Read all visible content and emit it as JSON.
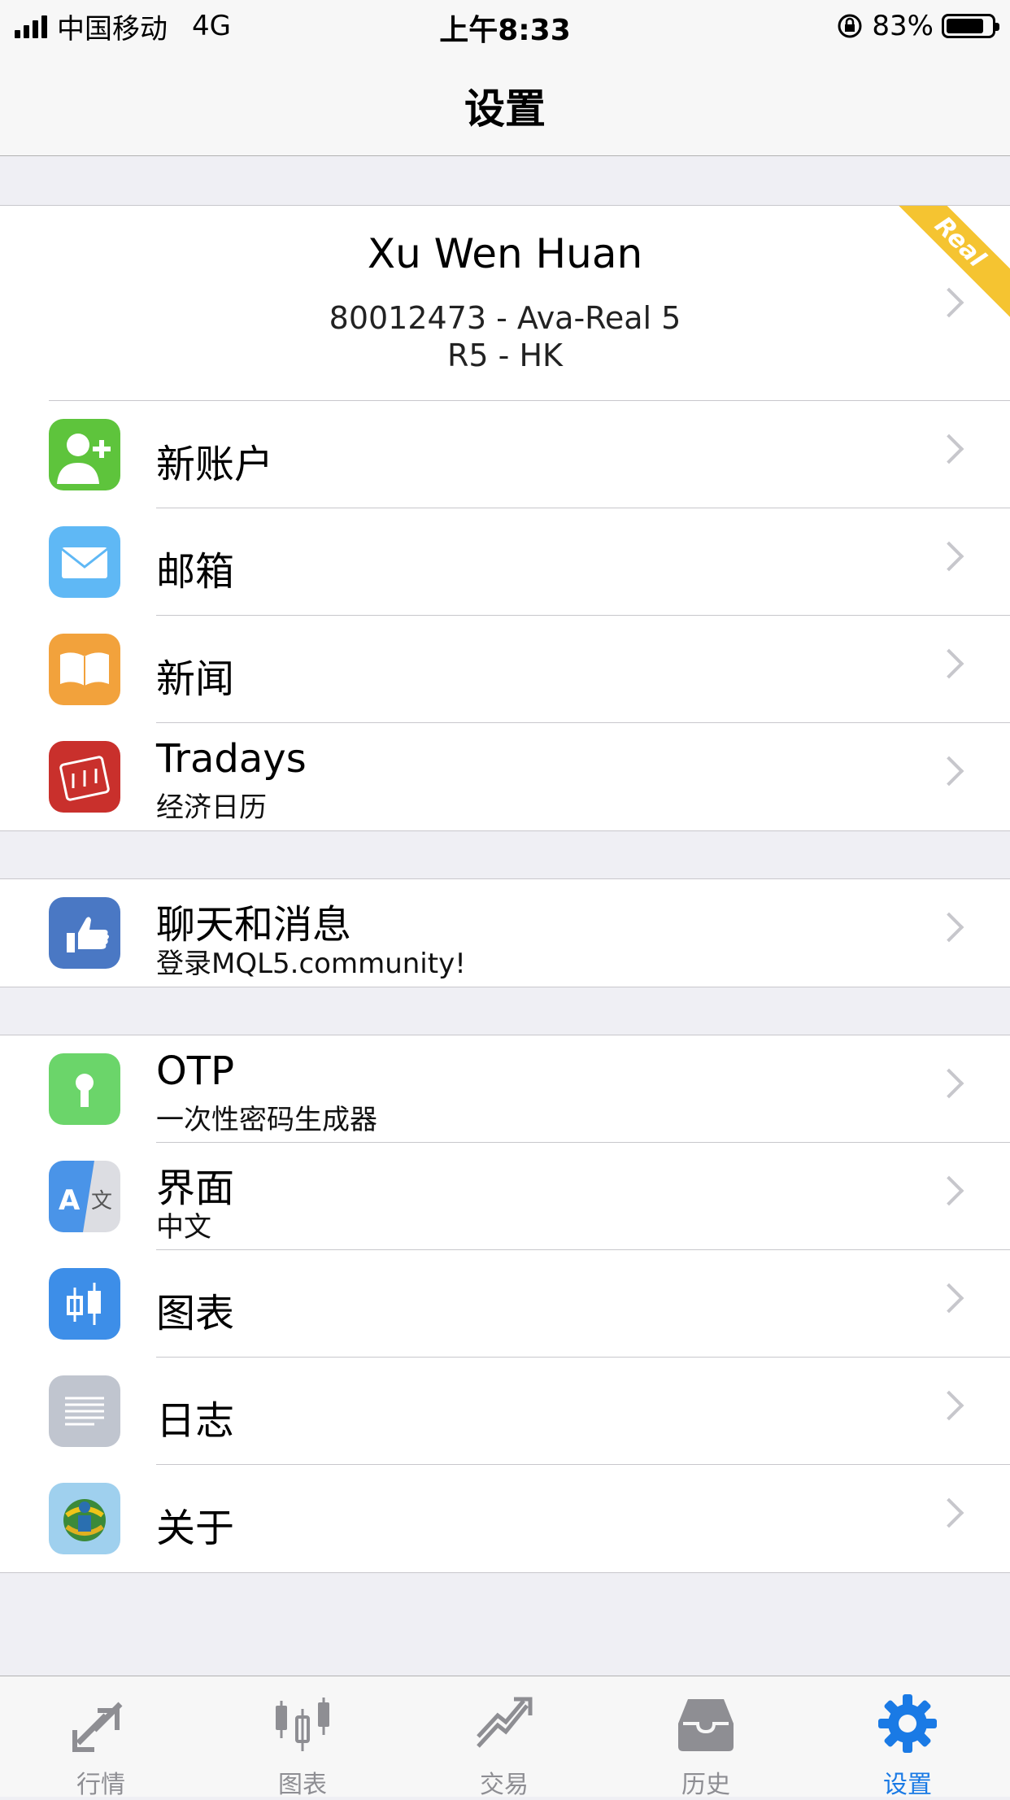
{
  "status_bar": {
    "carrier": "中国移动",
    "network": "4G",
    "time": "上午8:33",
    "battery_percent": "83%",
    "battery_level": 0.83
  },
  "nav": {
    "title": "设置"
  },
  "account": {
    "name": "Xu  Wen Huan",
    "line1": "80012473 - Ava-Real 5",
    "line2": "R5 - HK",
    "badge": "Real",
    "badge_color": "#f5c431"
  },
  "group1": [
    {
      "icon": "add-user-icon",
      "color": "#5ec43c",
      "label": "新账户"
    },
    {
      "icon": "mail-icon",
      "color": "#5fb8f5",
      "label": "邮箱"
    },
    {
      "icon": "book-icon",
      "color": "#f2a23c",
      "label": "新闻"
    },
    {
      "icon": "calendar-icon",
      "color": "#c9302c",
      "label": "Tradays",
      "sublabel": "经济日历"
    }
  ],
  "group2": [
    {
      "icon": "pointing-hand-icon",
      "color": "#4a78c4",
      "label": "聊天和消息",
      "sublabel": "登录MQL5.community!"
    }
  ],
  "group3": [
    {
      "icon": "keyhole-icon",
      "color": "#6bd56a",
      "label": "OTP",
      "sublabel": "一次性密码生成器"
    },
    {
      "icon": "language-icon",
      "color": "#4a94e8",
      "label": "界面",
      "sublabel": "中文"
    },
    {
      "icon": "candlestick-icon",
      "color": "#3d8ee8",
      "label": "图表"
    },
    {
      "icon": "log-icon",
      "color": "#c0c5cf",
      "label": "日志"
    },
    {
      "icon": "metatrader-logo-icon",
      "color": "#9fd0ee",
      "label": "关于"
    }
  ],
  "tabbar": {
    "tabs": [
      {
        "icon": "quotes-arrows-icon",
        "label": "行情"
      },
      {
        "icon": "chart-candles-icon",
        "label": "图表"
      },
      {
        "icon": "trade-trend-icon",
        "label": "交易"
      },
      {
        "icon": "history-inbox-icon",
        "label": "历史"
      },
      {
        "icon": "settings-gear-icon",
        "label": "设置"
      }
    ],
    "active_index": 4,
    "active_color": "#1a7ae5",
    "inactive_color": "#8e8e93"
  }
}
